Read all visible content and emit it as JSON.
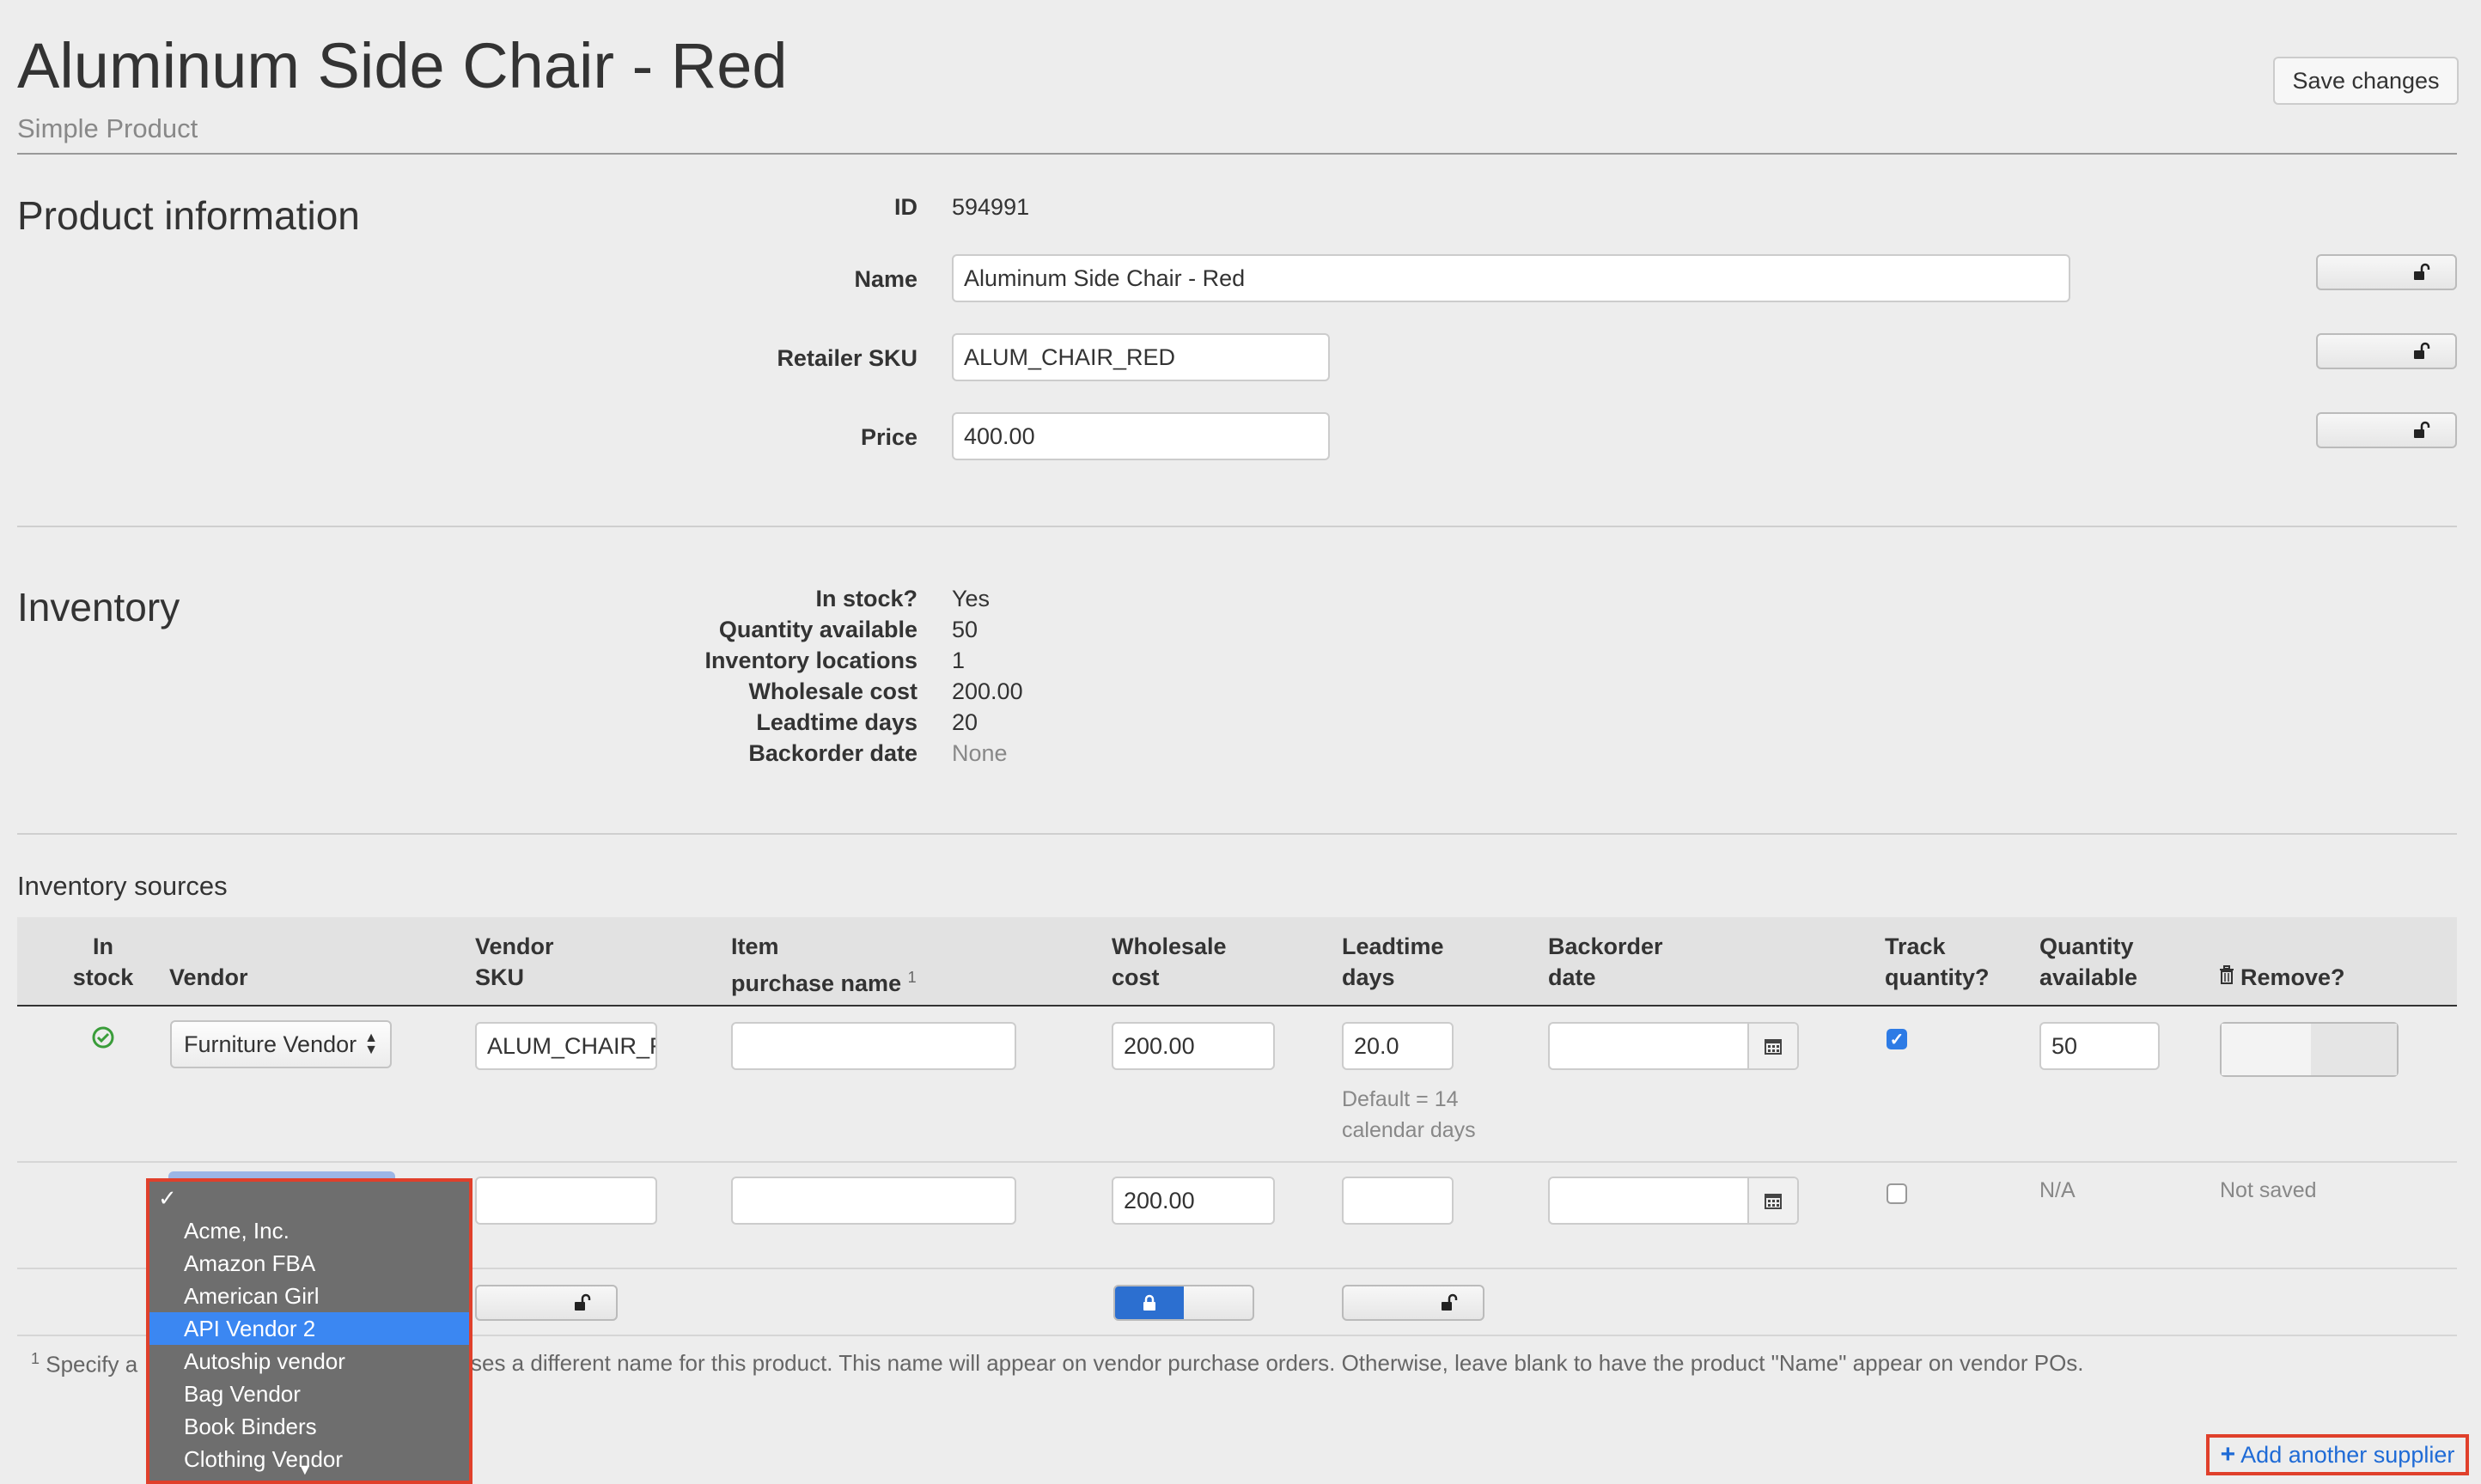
{
  "header": {
    "title": "Aluminum Side Chair - Red",
    "subtitle": "Simple Product",
    "save_label": "Save changes"
  },
  "product_info": {
    "heading": "Product information",
    "id_label": "ID",
    "id_value": "594991",
    "name_label": "Name",
    "name_value": "Aluminum Side Chair - Red",
    "sku_label": "Retailer SKU",
    "sku_value": "ALUM_CHAIR_RED",
    "price_label": "Price",
    "price_value": "400.00"
  },
  "inventory": {
    "heading": "Inventory",
    "rows": [
      {
        "label": "In stock?",
        "value": "Yes"
      },
      {
        "label": "Quantity available",
        "value": "50"
      },
      {
        "label": "Inventory locations",
        "value": "1"
      },
      {
        "label": "Wholesale cost",
        "value": "200.00"
      },
      {
        "label": "Leadtime days",
        "value": "20"
      },
      {
        "label": "Backorder date",
        "value": "None"
      }
    ]
  },
  "sources": {
    "heading": "Inventory sources",
    "columns": {
      "in_stock": [
        "In",
        "stock"
      ],
      "vendor": "Vendor",
      "vendor_sku": [
        "Vendor",
        "SKU"
      ],
      "item_purchase_name": [
        "Item",
        "purchase name"
      ],
      "footnote_marker": "1",
      "wholesale_cost": [
        "Wholesale",
        "cost"
      ],
      "leadtime_days": [
        "Leadtime",
        "days"
      ],
      "backorder_date": [
        "Backorder",
        "date"
      ],
      "track_quantity": [
        "Track",
        "quantity?"
      ],
      "quantity_available": [
        "Quantity",
        "available"
      ],
      "remove": "Remove?"
    },
    "row1": {
      "vendor": "Furniture Vendor",
      "vendor_sku": "ALUM_CHAIR_F",
      "item_purchase_name": "",
      "wholesale_cost": "200.00",
      "leadtime_days": "20.0",
      "leadtime_hint_1": "Default = 14",
      "leadtime_hint_2": "calendar days",
      "backorder_date": "",
      "track_quantity": true,
      "quantity_available": "50"
    },
    "row2": {
      "wholesale_cost": "200.00",
      "quantity_available": "N/A",
      "status": "Not saved"
    },
    "footnote": {
      "marker": "1",
      "text_start": "Specify a",
      "text_end": "ses a different name for this product. This name will appear on vendor purchase orders. Otherwise, leave blank to have the product \"Name\" appear on vendor POs."
    },
    "add_supplier_label": "Add another supplier"
  },
  "vendor_dropdown": {
    "checkmark": "✓",
    "options": [
      "Acme, Inc.",
      "Amazon FBA",
      "American Girl",
      "API Vendor 2",
      "Autoship vendor",
      "Bag Vendor",
      "Book Binders",
      "Clothing Vendor"
    ],
    "selected": "API Vendor 2"
  },
  "colors": {
    "accent": "#3b87f2",
    "highlight_border": "#e0402b",
    "link": "#1f6bd6",
    "success": "#3a9d3a"
  }
}
